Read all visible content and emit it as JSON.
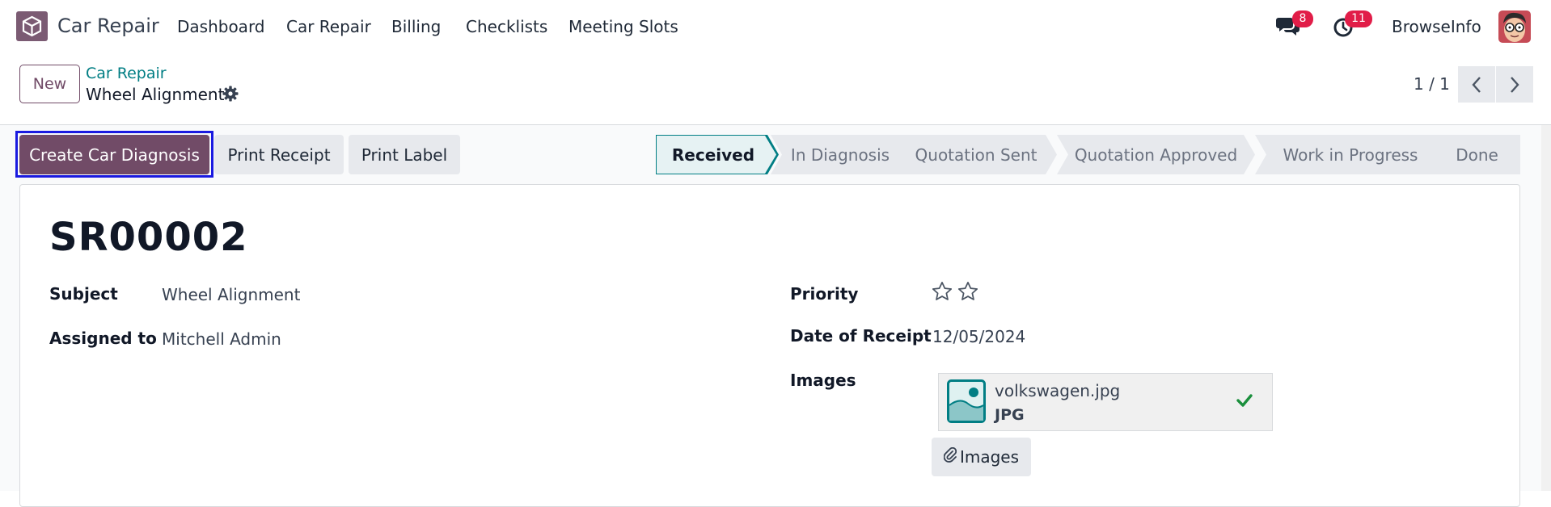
{
  "navbar": {
    "app_name": "Car Repair",
    "menu": [
      "Dashboard",
      "Car Repair",
      "Billing",
      "Checklists",
      "Meeting Slots"
    ],
    "messages_count": "8",
    "activities_count": "11",
    "user_name": "BrowseInfo"
  },
  "control_panel": {
    "new_label": "New",
    "breadcrumb_parent": "Car Repair",
    "breadcrumb_current": "Wheel Alignment",
    "pager": "1 / 1"
  },
  "actions": {
    "create_diagnosis": "Create Car Diagnosis",
    "print_receipt": "Print Receipt",
    "print_label": "Print Label"
  },
  "statusbar": {
    "stages": [
      "Received",
      "In Diagnosis",
      "Quotation Sent",
      "Quotation Approved",
      "Work in Progress",
      "Done"
    ],
    "active": "Received"
  },
  "form": {
    "record_name": "SR00002",
    "subject_label": "Subject",
    "subject_value": "Wheel Alignment",
    "assigned_label": "Assigned to",
    "assigned_value": "Mitchell Admin",
    "priority_label": "Priority",
    "priority_value": 0,
    "priority_max": 2,
    "date_label": "Date of Receipt",
    "date_value": "12/05/2024",
    "images_label": "Images",
    "attachment": {
      "name": "volkswagen.jpg",
      "type": "JPG"
    },
    "images_button": "Images"
  },
  "colors": {
    "brand": "#714b67",
    "accent_teal": "#017e84",
    "badge_red": "#e11d48",
    "focus_blue": "#1a1ae0"
  },
  "icons": [
    "app-logo-icon",
    "chat-icon",
    "clock-icon",
    "gear-icon",
    "chevron-left-icon",
    "chevron-right-icon",
    "star-outline-icon",
    "image-file-icon",
    "check-icon",
    "paperclip-icon"
  ]
}
